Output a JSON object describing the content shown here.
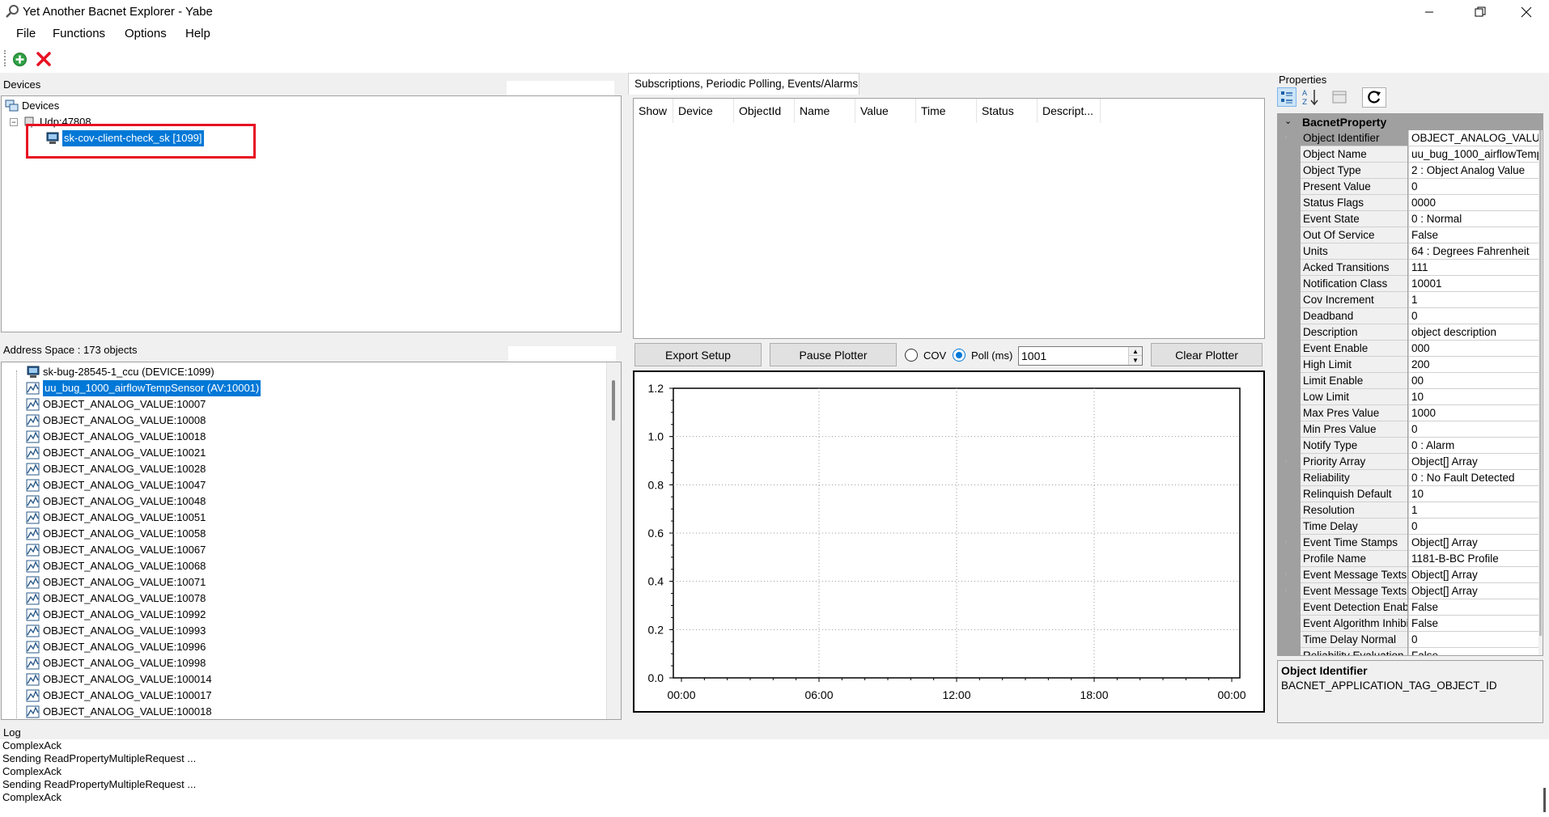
{
  "window": {
    "title": "Yet Another Bacnet Explorer - Yabe"
  },
  "menu": [
    "File",
    "Functions",
    "Options",
    "Help"
  ],
  "devices": {
    "label": "Devices",
    "root": "Devices",
    "transport": "Udp:47808",
    "device": "sk-cov-client-check_sk [1099]"
  },
  "address_space": {
    "label": "Address Space : 173 objects",
    "items": [
      "sk-bug-28545-1_ccu (DEVICE:1099)",
      "uu_bug_1000_airflowTempSensor (AV:10001)",
      "OBJECT_ANALOG_VALUE:10007",
      "OBJECT_ANALOG_VALUE:10008",
      "OBJECT_ANALOG_VALUE:10018",
      "OBJECT_ANALOG_VALUE:10021",
      "OBJECT_ANALOG_VALUE:10028",
      "OBJECT_ANALOG_VALUE:10047",
      "OBJECT_ANALOG_VALUE:10048",
      "OBJECT_ANALOG_VALUE:10051",
      "OBJECT_ANALOG_VALUE:10058",
      "OBJECT_ANALOG_VALUE:10067",
      "OBJECT_ANALOG_VALUE:10068",
      "OBJECT_ANALOG_VALUE:10071",
      "OBJECT_ANALOG_VALUE:10078",
      "OBJECT_ANALOG_VALUE:10992",
      "OBJECT_ANALOG_VALUE:10993",
      "OBJECT_ANALOG_VALUE:10996",
      "OBJECT_ANALOG_VALUE:10998",
      "OBJECT_ANALOG_VALUE:100014",
      "OBJECT_ANALOG_VALUE:100017",
      "OBJECT_ANALOG_VALUE:100018"
    ]
  },
  "subscriptions": {
    "tab": "Subscriptions, Periodic Polling, Events/Alarms",
    "columns": [
      "Show",
      "Device",
      "ObjectId",
      "Name",
      "Value",
      "Time",
      "Status",
      "Descript..."
    ]
  },
  "plotter": {
    "export_label": "Export Setup",
    "pause_label": "Pause Plotter",
    "cov_label": "COV",
    "poll_label": "Poll (ms)",
    "poll_value": "1001",
    "clear_label": "Clear Plotter",
    "selected_mode": "poll"
  },
  "chart_data": {
    "type": "line",
    "title": "",
    "xlabel": "",
    "ylabel": "",
    "x_ticks": [
      "00:00",
      "06:00",
      "12:00",
      "18:00",
      "00:00"
    ],
    "y_ticks": [
      "0.0",
      "0.2",
      "0.4",
      "0.6",
      "0.8",
      "1.0",
      "1.2"
    ],
    "ylim": [
      0,
      1.2
    ],
    "grid": true,
    "series": []
  },
  "properties": {
    "label": "Properties",
    "category": "BacnetProperty",
    "rows": [
      {
        "name": "Object Identifier",
        "value": "OBJECT_ANALOG_VALU",
        "expandable": true
      },
      {
        "name": "Object Name",
        "value": "uu_bug_1000_airflowTemp",
        "expandable": false
      },
      {
        "name": "Object Type",
        "value": "2 : Object Analog Value",
        "expandable": false
      },
      {
        "name": "Present Value",
        "value": "0",
        "expandable": false
      },
      {
        "name": "Status Flags",
        "value": "0000",
        "expandable": false
      },
      {
        "name": "Event State",
        "value": "0 : Normal",
        "expandable": false
      },
      {
        "name": "Out Of Service",
        "value": "False",
        "expandable": false
      },
      {
        "name": "Units",
        "value": "64 : Degrees Fahrenheit",
        "expandable": false
      },
      {
        "name": "Acked Transitions",
        "value": "111",
        "expandable": false
      },
      {
        "name": "Notification Class",
        "value": "10001",
        "expandable": false
      },
      {
        "name": "Cov Increment",
        "value": "1",
        "expandable": false
      },
      {
        "name": "Deadband",
        "value": "0",
        "expandable": false
      },
      {
        "name": "Description",
        "value": "object description",
        "expandable": false
      },
      {
        "name": "Event Enable",
        "value": "000",
        "expandable": false
      },
      {
        "name": "High Limit",
        "value": "200",
        "expandable": false
      },
      {
        "name": "Limit Enable",
        "value": "00",
        "expandable": false
      },
      {
        "name": "Low Limit",
        "value": "10",
        "expandable": false
      },
      {
        "name": "Max Pres Value",
        "value": "1000",
        "expandable": false
      },
      {
        "name": "Min Pres Value",
        "value": "0",
        "expandable": false
      },
      {
        "name": "Notify Type",
        "value": "0 : Alarm",
        "expandable": false
      },
      {
        "name": "Priority Array",
        "value": "Object[] Array",
        "expandable": true
      },
      {
        "name": "Reliability",
        "value": "0 : No Fault Detected",
        "expandable": false
      },
      {
        "name": "Relinquish Default",
        "value": "10",
        "expandable": false
      },
      {
        "name": "Resolution",
        "value": "1",
        "expandable": false
      },
      {
        "name": "Time Delay",
        "value": "0",
        "expandable": false
      },
      {
        "name": "Event Time Stamps",
        "value": "Object[] Array",
        "expandable": true
      },
      {
        "name": "Profile Name",
        "value": "1181-B-BC Profile",
        "expandable": false
      },
      {
        "name": "Event Message Texts",
        "value": "Object[] Array",
        "expandable": true
      },
      {
        "name": "Event Message Texts",
        "value": "Object[] Array",
        "expandable": true
      },
      {
        "name": "Event Detection Enab",
        "value": "False",
        "expandable": false
      },
      {
        "name": "Event Algorithm Inhibi",
        "value": "False",
        "expandable": false
      },
      {
        "name": "Time Delay Normal",
        "value": "0",
        "expandable": false
      },
      {
        "name": "Reliability Evaluation I",
        "value": "False",
        "expandable": false
      }
    ],
    "help_title": "Object Identifier",
    "help_text": "BACNET_APPLICATION_TAG_OBJECT_ID"
  },
  "log": {
    "label": "Log",
    "lines": [
      "ComplexAck",
      "Sending ReadPropertyMultipleRequest ...",
      "ComplexAck",
      "Sending ReadPropertyMultipleRequest ...",
      "ComplexAck"
    ]
  },
  "colors": {
    "selection": "#0078d7",
    "highlight_box": "#e81123",
    "add_icon": "#2ea043",
    "delete_icon": "#e81123"
  }
}
